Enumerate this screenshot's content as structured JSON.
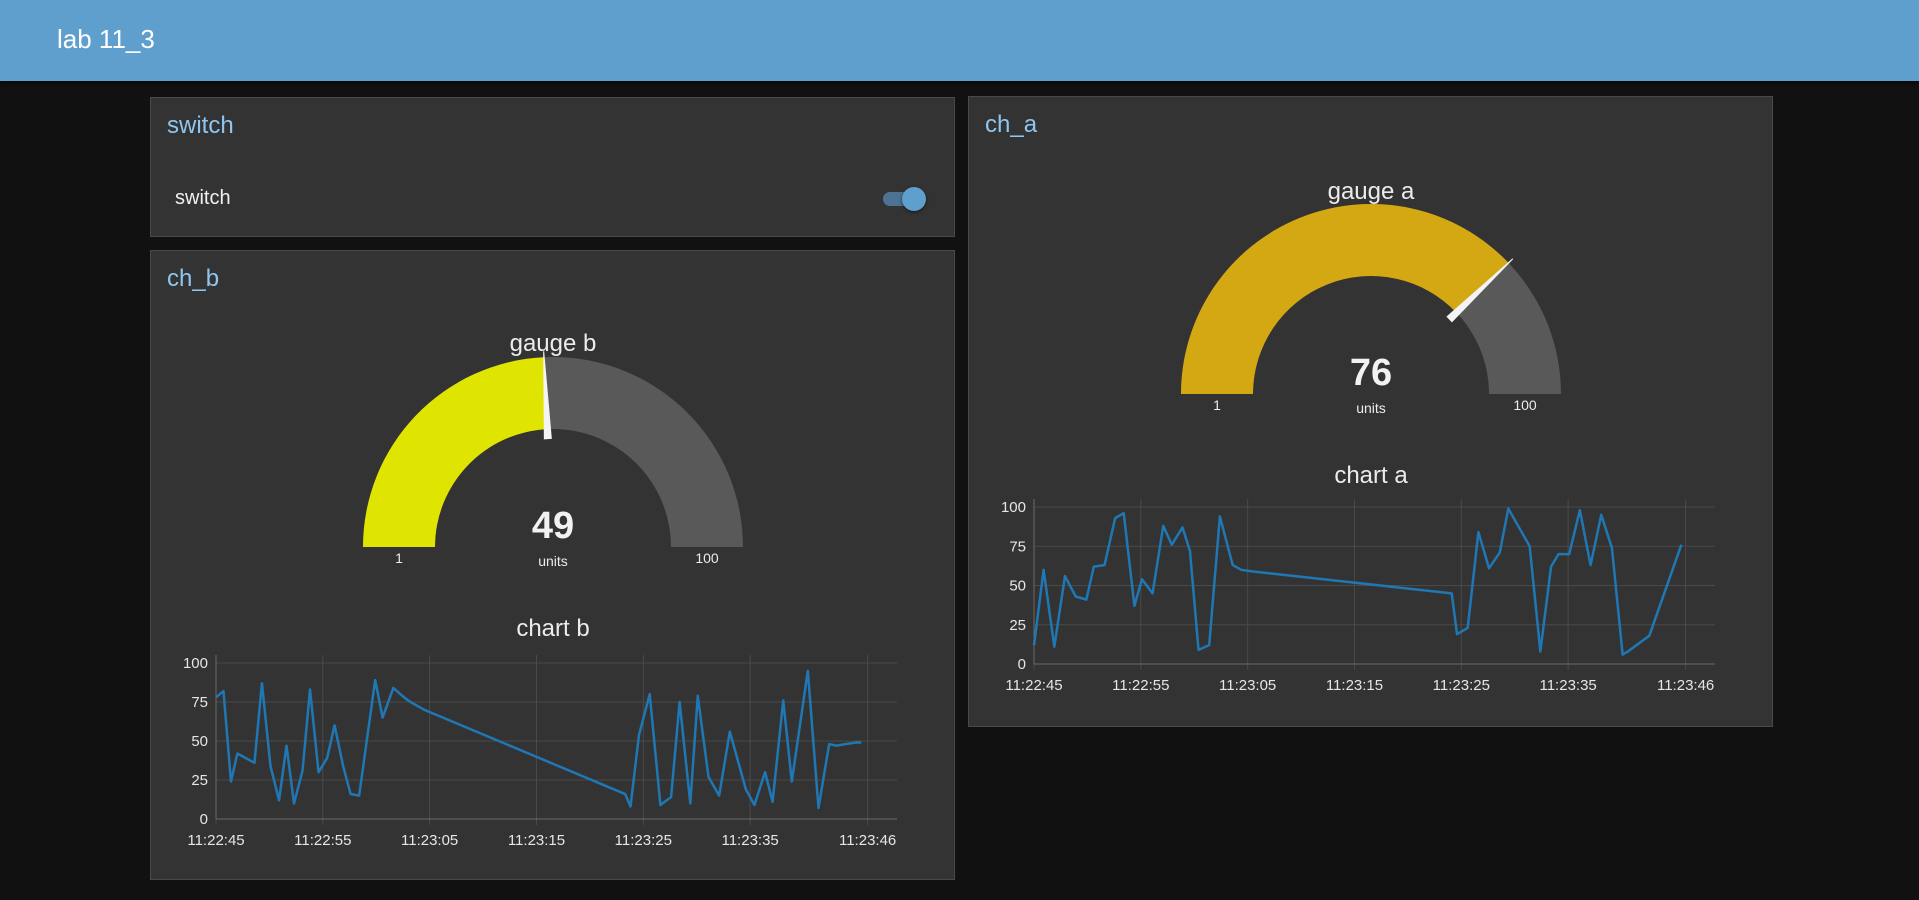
{
  "app": {
    "title": "lab 11_3"
  },
  "switch_group": {
    "title": "switch",
    "label": "switch",
    "state": "on"
  },
  "ch_b": {
    "title": "ch_b",
    "gauge": {
      "label": "gauge b",
      "value": "49",
      "units": "units",
      "min_label": "1",
      "max_label": "100",
      "value_num": 49,
      "min": 1,
      "max": 100,
      "color": "#dfe500"
    }
  },
  "ch_a": {
    "title": "ch_a",
    "gauge": {
      "label": "gauge a",
      "value": "76",
      "units": "units",
      "min_label": "1",
      "max_label": "100",
      "value_num": 76,
      "min": 1,
      "max": 100,
      "color": "#d4a812"
    }
  },
  "colors": {
    "header": "#5f9fce",
    "card": "#333333",
    "card_title": "#8fc6f0",
    "gauge_track": "#595959",
    "line": "#1f77b4",
    "grid": "#4a4a4a"
  },
  "chart_data": [
    {
      "id": "chart_b",
      "type": "line",
      "title": "chart b",
      "xlabel": "",
      "ylabel": "",
      "x_ticks": [
        "11:22:45",
        "11:22:55",
        "11:23:05",
        "11:23:15",
        "11:23:25",
        "11:23:35",
        "11:23:46"
      ],
      "y_ticks": [
        "0",
        "25",
        "50",
        "75",
        "100"
      ],
      "ylim": [
        0,
        100
      ],
      "xlim": [
        0,
        63
      ],
      "grid": true,
      "series": [
        {
          "x": [
            0,
            0.7,
            1.4,
            2.0,
            3.6,
            4.3,
            5.1,
            5.9,
            6.6,
            7.3,
            8.1,
            8.8,
            9.6,
            10.4,
            11.1,
            11.9,
            12.6,
            13.4,
            14.9,
            15.6,
            16.6,
            17.6,
            18.2,
            19.5,
            38.3,
            38.8,
            39.6,
            40.6,
            41.6,
            42.6,
            43.4,
            44.4,
            45.1,
            46.1,
            47.1,
            48.1,
            49.6,
            50.4,
            51.4,
            52.1,
            53.1,
            53.9,
            55.4,
            56.4,
            57.4,
            58.1,
            58.9,
            59.9,
            60.4
          ],
          "y": [
            78,
            82,
            24,
            42,
            36,
            87,
            34,
            12,
            47,
            10,
            31,
            83,
            30,
            39,
            60,
            34,
            16,
            15,
            89,
            65,
            84,
            78,
            75,
            70,
            16,
            8,
            54,
            80,
            9,
            14,
            75,
            10,
            79,
            27,
            15,
            56,
            19,
            9,
            30,
            11,
            76,
            24,
            95,
            7,
            48,
            47,
            48,
            49,
            49
          ]
        }
      ]
    },
    {
      "id": "chart_a",
      "type": "line",
      "title": "chart a",
      "xlabel": "",
      "ylabel": "",
      "x_ticks": [
        "11:22:45",
        "11:22:55",
        "11:23:05",
        "11:23:15",
        "11:23:25",
        "11:23:35",
        "11:23:46"
      ],
      "y_ticks": [
        "0",
        "25",
        "50",
        "75",
        "100"
      ],
      "ylim": [
        0,
        100
      ],
      "xlim": [
        0,
        63
      ],
      "grid": true,
      "series": [
        {
          "x": [
            0,
            0.9,
            1.9,
            2.9,
            3.9,
            4.9,
            5.6,
            6.6,
            7.6,
            8.4,
            9.4,
            10.1,
            11.1,
            12.1,
            12.9,
            13.9,
            14.6,
            15.4,
            16.4,
            17.4,
            18.6,
            19.4,
            20.4,
            39.1,
            39.6,
            40.6,
            41.6,
            42.6,
            43.6,
            44.4,
            46.4,
            47.4,
            48.4,
            49.1,
            50.1,
            51.1,
            52.1,
            53.1,
            54.1,
            55.1,
            55.6,
            57.6,
            60.6
          ],
          "y": [
            12,
            60,
            11,
            56,
            43,
            41,
            62,
            63,
            93,
            96,
            37,
            54,
            45,
            88,
            76,
            87,
            72,
            9,
            12,
            94,
            63,
            60,
            59,
            45,
            19,
            23,
            84,
            61,
            71,
            99,
            75,
            8,
            62,
            70,
            70,
            98,
            63,
            95,
            74,
            6,
            8,
            18,
            76
          ]
        }
      ]
    }
  ]
}
